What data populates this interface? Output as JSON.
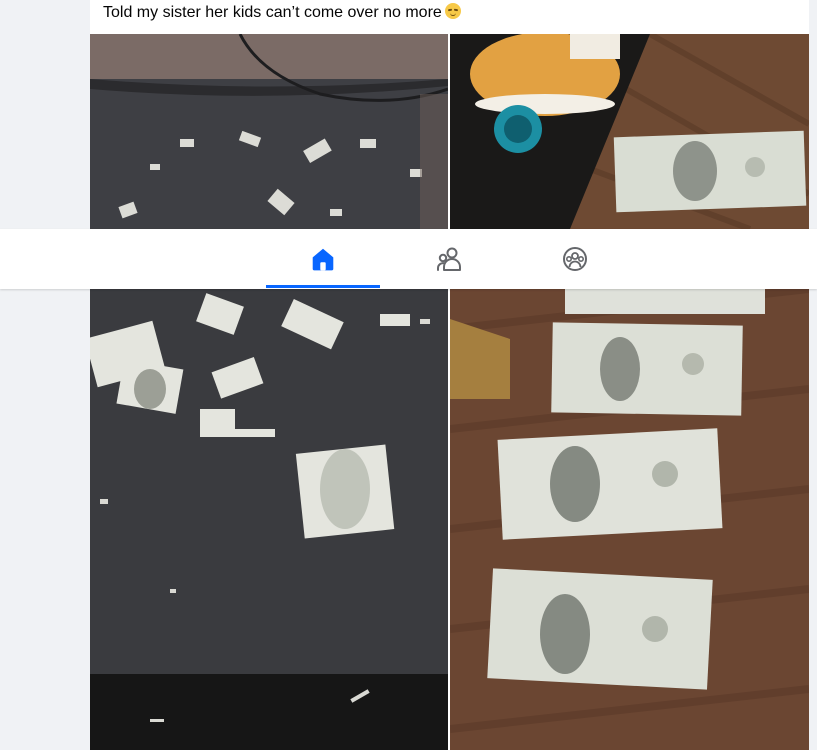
{
  "post": {
    "caption": "Told my sister her kids can’t come over no more",
    "caption_emoji": "relieved-face-emoji"
  },
  "navbar": {
    "tabs": [
      {
        "name": "home",
        "icon": "home-icon",
        "active": true
      },
      {
        "name": "friends",
        "icon": "friends-icon",
        "active": false
      },
      {
        "name": "groups",
        "icon": "groups-icon",
        "active": false
      }
    ],
    "active_color": "#0866ff",
    "inactive_color": "#65676b"
  },
  "colors": {
    "page_background": "#f0f2f5",
    "card_background": "#ffffff",
    "caption_text": "#050505"
  }
}
